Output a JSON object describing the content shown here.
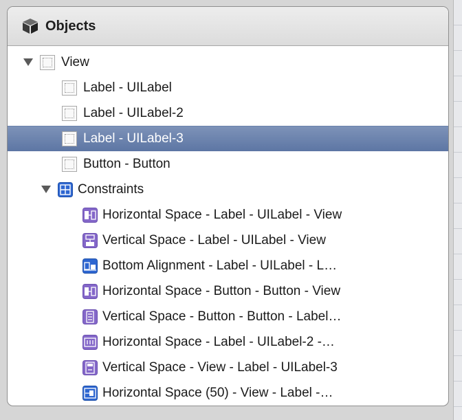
{
  "panel": {
    "title": "Objects",
    "header_icon": "cube-icon"
  },
  "tree": {
    "view": {
      "label": "View",
      "expanded": true,
      "icon": "view-icon"
    },
    "children": [
      {
        "label": "Label - UILabel",
        "icon": "view-icon"
      },
      {
        "label": "Label - UILabel-2",
        "icon": "view-icon"
      },
      {
        "label": "Label - UILabel-3",
        "icon": "view-icon",
        "selected": true
      },
      {
        "label": "Button - Button",
        "icon": "view-icon"
      }
    ],
    "constraints": {
      "label": "Constraints",
      "expanded": true,
      "icon": "constraints-icon",
      "items": [
        {
          "label": "Horizontal Space - Label - UILabel - View",
          "icon": "horizontal-space-icon",
          "color": "#8467c9"
        },
        {
          "label": "Vertical Space - Label - UILabel - View",
          "icon": "vertical-space-icon",
          "color": "#8467c9"
        },
        {
          "label": "Bottom Alignment - Label - UILabel - L…",
          "icon": "bottom-alignment-icon",
          "color": "#2e66d1"
        },
        {
          "label": "Horizontal Space - Button - Button - View",
          "icon": "horizontal-space-icon",
          "color": "#8467c9"
        },
        {
          "label": "Vertical Space - Button - Button - Label…",
          "icon": "vertical-space-icon",
          "color": "#8467c9"
        },
        {
          "label": "Horizontal Space - Label - UILabel-2 -…",
          "icon": "horizontal-space-icon",
          "color": "#8467c9"
        },
        {
          "label": "Vertical Space - View - Label - UILabel-3",
          "icon": "vertical-space-icon",
          "color": "#8467c9"
        },
        {
          "label": "Horizontal Space (50) - View - Label -…",
          "icon": "horizontal-space-icon",
          "color": "#2e66d1"
        }
      ]
    }
  },
  "colors": {
    "selection": "#6b82ad",
    "constraint_purple": "#8467c9",
    "constraint_blue": "#2e66d1"
  }
}
